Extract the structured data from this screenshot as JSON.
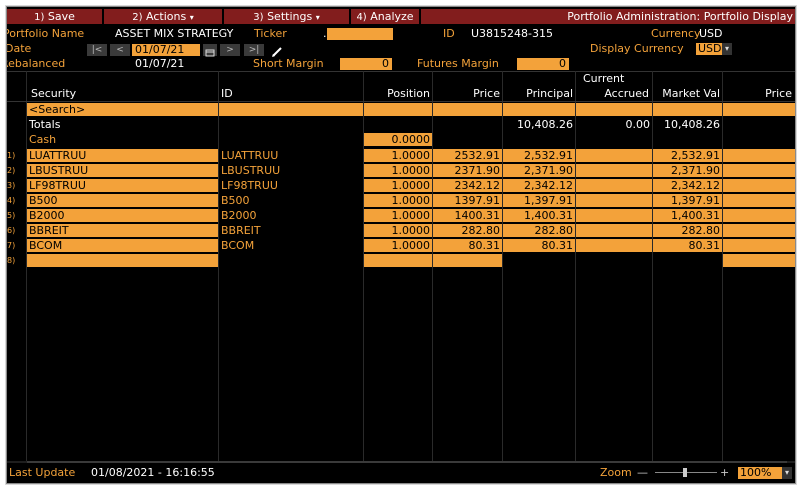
{
  "menu": {
    "save": {
      "num": "1)",
      "label": "Save"
    },
    "actions": {
      "num": "2)",
      "label": "Actions",
      "caret": "▾"
    },
    "settings": {
      "num": "3)",
      "label": "Settings",
      "caret": "▾"
    },
    "analyze": {
      "num": "4)",
      "label": "Analyze"
    },
    "title": "Portfolio Administration: Portfolio Display"
  },
  "portfolio": {
    "name_label": "Portfolio Name",
    "name_value": "ASSET MIX STRATEGY",
    "ticker_label": "Ticker",
    "ticker_value": ".",
    "id_label": "ID",
    "id_value": "U3815248-315",
    "currency_label": "Currency",
    "currency_value": "USD",
    "date_label": "Date",
    "date_value": "01/07/21",
    "display_currency_label": "Display Currency",
    "display_currency_value": "USD",
    "rebalanced_label": "Rebalanced",
    "rebalanced_value": "01/07/21",
    "short_margin_label": "Short Margin",
    "short_margin_value": "0",
    "futures_margin_label": "Futures Margin",
    "futures_margin_value": "0"
  },
  "nav": {
    "first": "|<",
    "prev": "<",
    "next": ">",
    "last": ">|",
    "calendar_icon": "calendar-icon",
    "edit_icon": "pencil-icon"
  },
  "table": {
    "group_header": "Current",
    "columns": {
      "security": "Security",
      "id": "ID",
      "position": "Position",
      "price": "Price",
      "principal": "Principal",
      "accrued": "Accrued",
      "market_val": "Market Val",
      "price2": "Price"
    },
    "search_placeholder": "<Search>",
    "totals": {
      "label": "Totals",
      "principal": "10,408.26",
      "accrued": "0.00",
      "market_val": "10,408.26"
    },
    "cash": {
      "label": "Cash",
      "position": "0.0000"
    },
    "rows": [
      {
        "num": "1)",
        "security": "LUATTRUU",
        "id": "LUATTRUU",
        "position": "1.0000",
        "price": "2532.91",
        "principal": "2,532.91",
        "market_val": "2,532.91"
      },
      {
        "num": "2)",
        "security": "LBUSTRUU",
        "id": "LBUSTRUU",
        "position": "1.0000",
        "price": "2371.90",
        "principal": "2,371.90",
        "market_val": "2,371.90"
      },
      {
        "num": "3)",
        "security": "LF98TRUU",
        "id": "LF98TRUU",
        "position": "1.0000",
        "price": "2342.12",
        "principal": "2,342.12",
        "market_val": "2,342.12"
      },
      {
        "num": "4)",
        "security": "B500",
        "id": "B500",
        "position": "1.0000",
        "price": "1397.91",
        "principal": "1,397.91",
        "market_val": "1,397.91"
      },
      {
        "num": "5)",
        "security": "B2000",
        "id": "B2000",
        "position": "1.0000",
        "price": "1400.31",
        "principal": "1,400.31",
        "market_val": "1,400.31"
      },
      {
        "num": "6)",
        "security": "BBREIT",
        "id": "BBREIT",
        "position": "1.0000",
        "price": "282.80",
        "principal": "282.80",
        "market_val": "282.80"
      },
      {
        "num": "7)",
        "security": "BCOM",
        "id": "BCOM",
        "position": "1.0000",
        "price": "80.31",
        "principal": "80.31",
        "market_val": "80.31"
      }
    ],
    "empty_row_num": "8)"
  },
  "status": {
    "last_update_label": "Last Update",
    "last_update_value": "01/08/2021 - 16:16:55",
    "zoom_label": "Zoom",
    "zoom_minus": "—",
    "zoom_plus": "+",
    "zoom_value": "100%"
  },
  "colors": {
    "accent": "#f3a23a",
    "menu_bg": "#821d1d",
    "background": "#000000"
  }
}
